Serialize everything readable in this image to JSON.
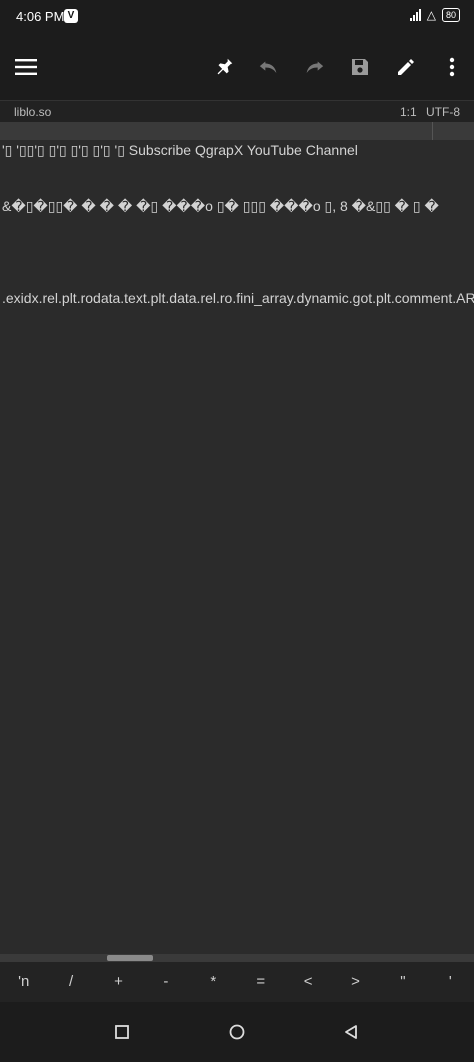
{
  "status_bar": {
    "time": "4:06 PM",
    "app_icon_letter": "V",
    "battery": "80"
  },
  "toolbar": {
    "icons": [
      "menu-icon",
      "pin-icon",
      "undo-icon",
      "redo-icon",
      "save-icon",
      "edit-icon",
      "more-vert-icon"
    ]
  },
  "file_bar": {
    "filename": "liblo.so",
    "position": "1:1",
    "encoding": "UTF-8"
  },
  "editor": {
    "lines": [
      "'▯  '▯▯'▯ ▯'▯ ▯'▯ ▯'▯   '▯ Subscribe  QgrapX  YouTube  Channel",
      "&�▯�▯▯�  �  �  �  �▯  ���o  ▯�  ▯▯▯  ���o  ▯, 8  �&▯▯  �   ▯  �",
      ".exidx.rel.plt.rodata.text.plt.data.rel.ro.fini_array.dynamic.got.plt.comment.ARM.attributes"
    ]
  },
  "symbol_bar": {
    "keys": [
      "'n",
      "/",
      "+",
      "-",
      "*",
      "=",
      "<",
      ">",
      "\"",
      "'"
    ]
  },
  "nav_bar": {
    "icons": [
      "recents-square-icon",
      "home-circle-icon",
      "back-triangle-icon"
    ]
  },
  "colors": {
    "bar_background": "#1c1c1c",
    "editor_background": "#2b2b2b",
    "text": "#d3d3d3"
  }
}
